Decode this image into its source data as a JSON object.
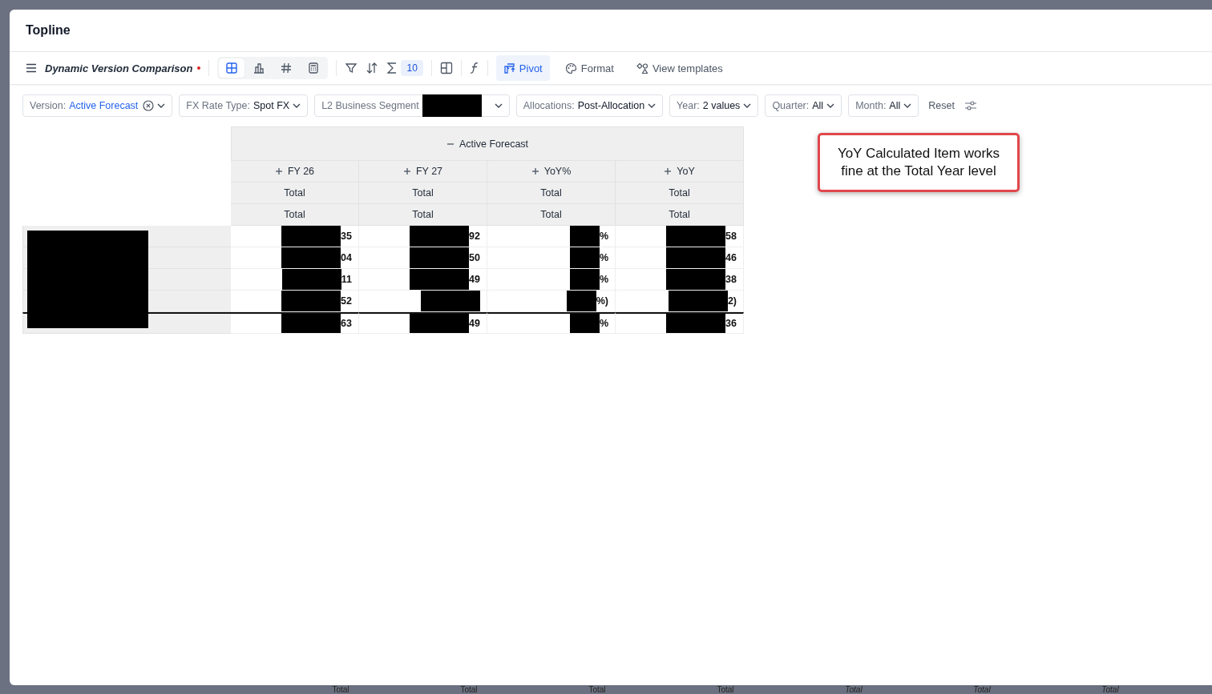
{
  "window": {
    "title": "Topline"
  },
  "toolbar": {
    "view_name": "Dynamic Version Comparison",
    "unsaved": true,
    "view_modes": [
      {
        "kind": "table",
        "selected": true
      },
      {
        "kind": "chart",
        "selected": false
      },
      {
        "kind": "number",
        "selected": false
      },
      {
        "kind": "calculator",
        "selected": false
      }
    ],
    "total_count": "10",
    "actions": [
      {
        "kind": "pivot",
        "label": "Pivot",
        "selected": true
      },
      {
        "kind": "format",
        "label": "Format",
        "selected": false
      },
      {
        "kind": "templates",
        "label": "View templates",
        "selected": false
      }
    ]
  },
  "filters": [
    {
      "kind": "clearable",
      "label": "Version:",
      "value": "Active Forecast"
    },
    {
      "kind": "plain",
      "label": "FX Rate Type:",
      "value": "Spot FX"
    },
    {
      "kind": "redacted",
      "label": "L2 Business Segment"
    },
    {
      "kind": "plain",
      "label": "Allocations:",
      "value": "Post-Allocation"
    },
    {
      "kind": "plain",
      "label": "Year:",
      "value": "2 values"
    },
    {
      "kind": "plain",
      "label": "Quarter:",
      "value": "All"
    },
    {
      "kind": "plain",
      "label": "Month:",
      "value": "All"
    }
  ],
  "reset": "Reset",
  "table": {
    "group": "Active Forecast",
    "group_expanded": true,
    "columns": [
      {
        "name": "FY 26",
        "expanded": false,
        "sub1": "Total",
        "sub2": "Total"
      },
      {
        "name": "FY 27",
        "expanded": false,
        "sub1": "Total",
        "sub2": "Total"
      },
      {
        "name": "YoY%",
        "expanded": false,
        "sub1": "Total",
        "sub2": "Total"
      },
      {
        "name": "YoY",
        "expanded": false,
        "sub1": "Total",
        "sub2": "Total"
      }
    ],
    "rows": [
      {
        "kind": "detail",
        "cells": [
          "35",
          "92",
          "%",
          "58"
        ]
      },
      {
        "kind": "detail",
        "cells": [
          "04",
          "50",
          "%",
          "46"
        ]
      },
      {
        "kind": "detail",
        "cells": [
          "11",
          "49",
          "%",
          "38"
        ]
      },
      {
        "kind": "detail",
        "cells": [
          "52",
          "",
          "%)",
          "2)"
        ]
      },
      {
        "kind": "total",
        "cells": [
          "63",
          "49",
          "%",
          "36"
        ]
      }
    ]
  },
  "annotation": "YoY Calculated Item works fine at the Total Year level",
  "background_strip": [
    {
      "text": "Total",
      "italic": false
    },
    {
      "text": "Total",
      "italic": false
    },
    {
      "text": "Total",
      "italic": false
    },
    {
      "text": "Total",
      "italic": false
    },
    {
      "text": "Total",
      "italic": true
    },
    {
      "text": "Total",
      "italic": true
    },
    {
      "text": "Total",
      "italic": true
    }
  ]
}
